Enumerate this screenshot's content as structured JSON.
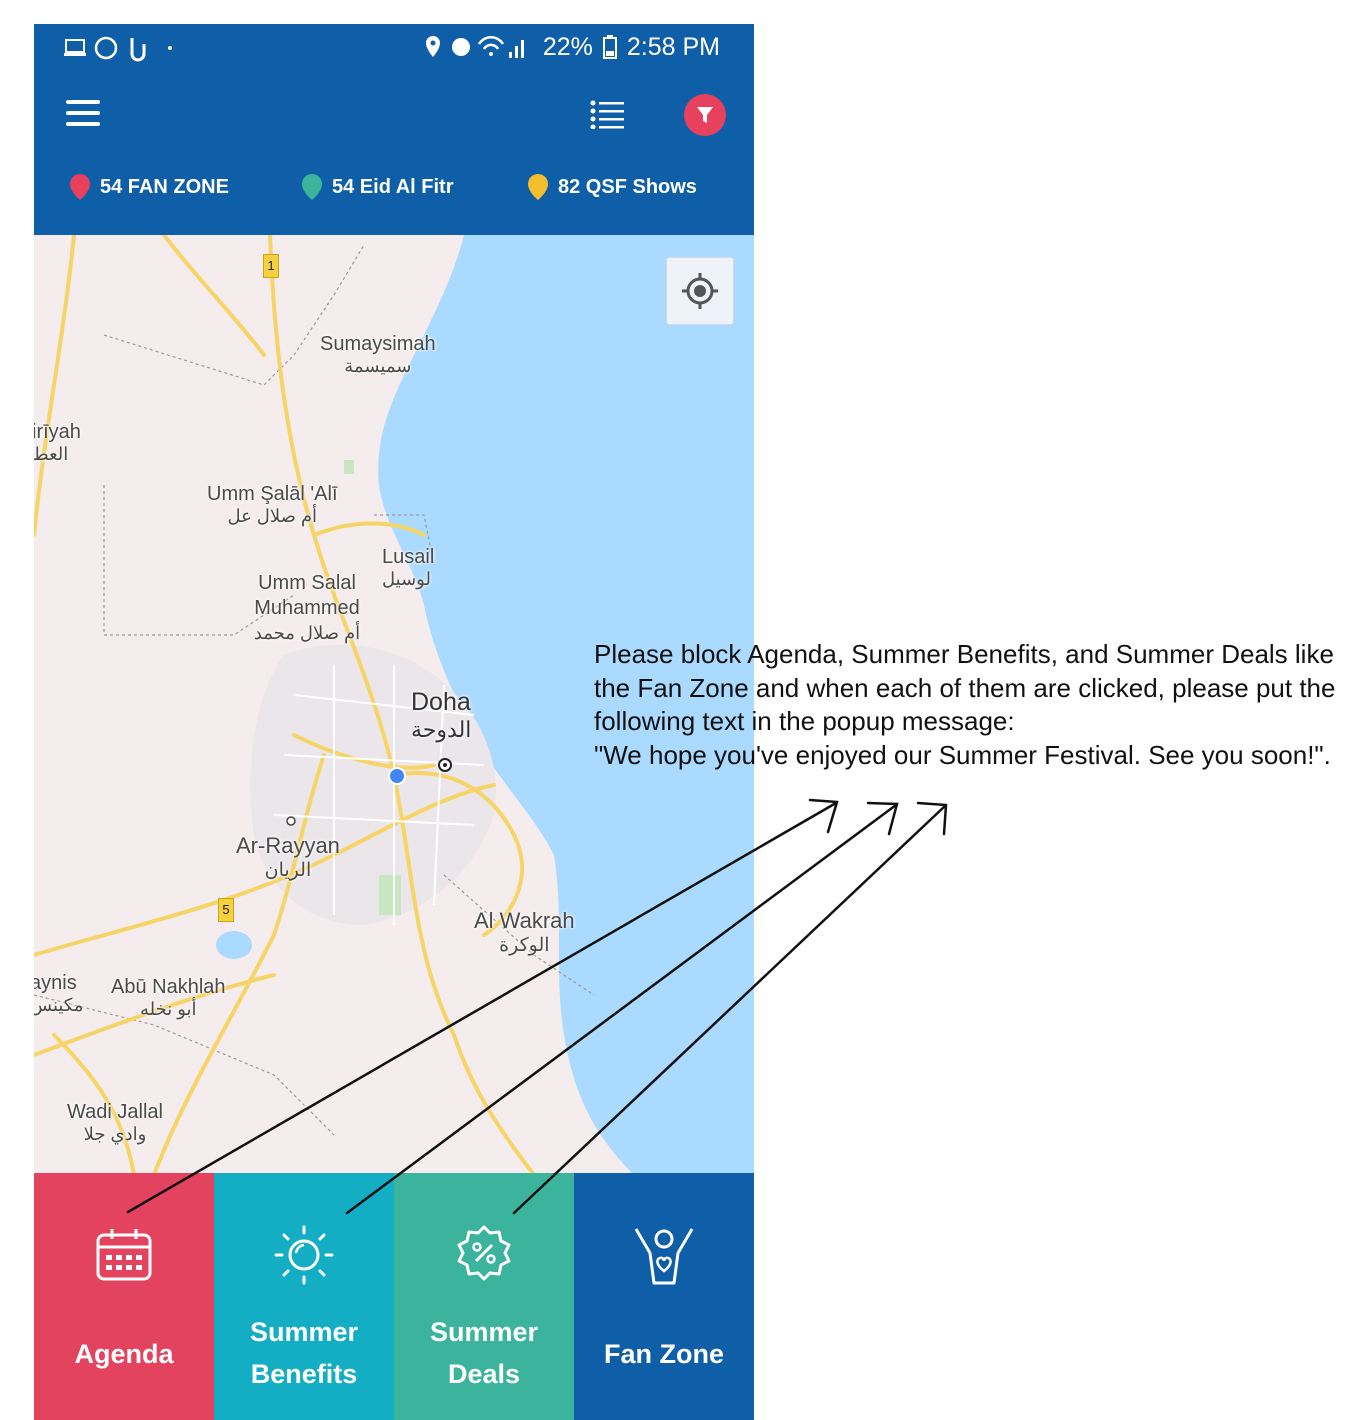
{
  "status_bar": {
    "battery": "22%",
    "time": "2:58 PM"
  },
  "legend": [
    {
      "label": "54 FAN ZONE",
      "color": "#e8415e"
    },
    {
      "label": "54 Eid Al Fitr",
      "color": "#3cb49c"
    },
    {
      "label": "82 QSF Shows",
      "color": "#f4be2c"
    }
  ],
  "map": {
    "places": [
      {
        "en": "Sumaysimah",
        "ar": "سميسمة"
      },
      {
        "en": "irīyah",
        "ar": "العط"
      },
      {
        "en": "Umm Şalāl 'Alī",
        "ar": "أم صلال عل"
      },
      {
        "en": "Lusail",
        "ar": "لوسيل"
      },
      {
        "en": "Umm Salal Muhammed",
        "ar": "أم صلال محمد"
      },
      {
        "en": "Doha",
        "ar": "الدوحة"
      },
      {
        "en": "Ar-Rayyan",
        "ar": "الريان"
      },
      {
        "en": "Al Wakrah",
        "ar": "الوكرة"
      },
      {
        "en": "aynis",
        "ar": "مكينس"
      },
      {
        "en": "Abū Nakhlah",
        "ar": "أبو نخله"
      },
      {
        "en": "Wadi Jallal",
        "ar": "وادي جلا"
      }
    ],
    "road_shields": [
      "1",
      "5"
    ]
  },
  "tabs": [
    {
      "label_line1": "Agenda",
      "label_line2": "",
      "color": "#e4435f"
    },
    {
      "label_line1": "Summer",
      "label_line2": "Benefits",
      "color": "#13aec4"
    },
    {
      "label_line1": "Summer",
      "label_line2": "Deals",
      "color": "#3bb39d"
    },
    {
      "label_line1": "Fan Zone",
      "label_line2": "",
      "color": "#0f5ea8"
    }
  ],
  "annotation": {
    "lines": [
      "Please block Agenda, Summer Benefits, and Summer Deals like",
      "the Fan Zone and when each of them are clicked, please put the",
      "following text in the popup message:",
      "\"We hope you've enjoyed our Summer Festival. See you soon!\"."
    ]
  }
}
